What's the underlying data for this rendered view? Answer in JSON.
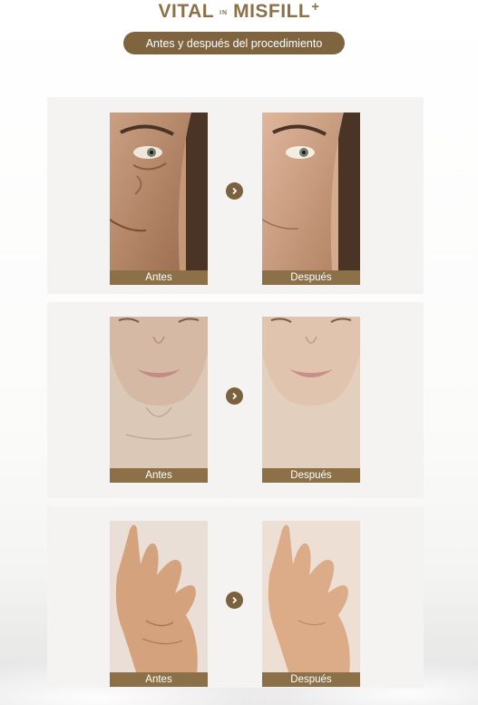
{
  "brand": {
    "word_left": "VITAL",
    "word_small": "IN",
    "word_right": "MISFILL",
    "plus": "+"
  },
  "subtitle": "Antes y después del procedimiento",
  "comparisons": [
    {
      "area": "face-eye",
      "before_label": "Antes",
      "after_label": "Después"
    },
    {
      "area": "chin-neck",
      "before_label": "Antes",
      "after_label": "Después"
    },
    {
      "area": "hand",
      "before_label": "Antes",
      "after_label": "Después"
    }
  ],
  "icons": {
    "next": "chevron-right-icon"
  },
  "colors": {
    "accent": "#8c7148",
    "pill": "#7f6440",
    "card": "#f4f3f1"
  }
}
